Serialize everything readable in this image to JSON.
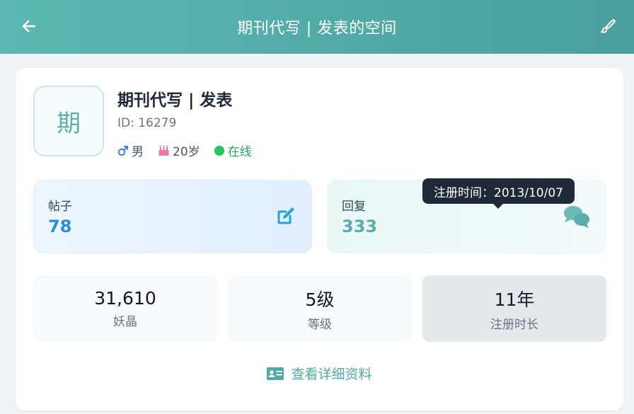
{
  "header": {
    "title": "期刊代写 | 发表的空间"
  },
  "profile": {
    "avatar_char": "期",
    "name": "期刊代写 | 发表",
    "id": "ID: 16279",
    "gender": "男",
    "age": "20岁",
    "status": "在线"
  },
  "stats": {
    "posts": {
      "label": "帖子",
      "value": "78"
    },
    "replies": {
      "label": "回复",
      "value": "333"
    }
  },
  "tooltip": "注册时间：2013/10/07",
  "mini_stats": [
    {
      "value": "31,610",
      "label": "妖晶"
    },
    {
      "value": "5级",
      "label": "等级"
    },
    {
      "value": "11年",
      "label": "注册时长"
    }
  ],
  "detail_link": "查看详细资料",
  "colors": {
    "header_start": "#5db8b2",
    "header_end": "#4a9f9c",
    "posts_accent": "#2a8fd6",
    "replies_accent": "#5aadaa",
    "online": "#22c55e"
  },
  "icons": {
    "back": "arrow-left-icon",
    "edit": "paintbrush-icon",
    "gender": "male-icon",
    "age": "birthday-cake-icon",
    "posts": "edit-square-icon",
    "replies": "comments-icon",
    "detail": "id-card-icon"
  }
}
